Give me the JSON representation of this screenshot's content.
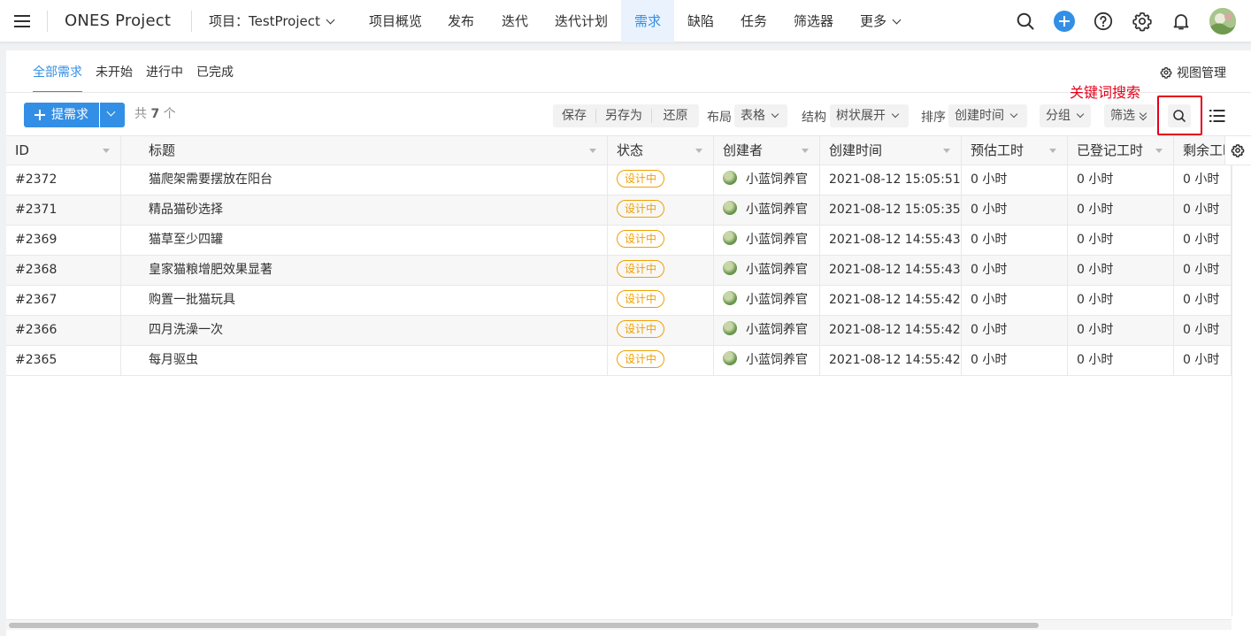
{
  "app": {
    "name": "ONES Project"
  },
  "topnav": {
    "project_label": "项目：TestProject",
    "items": [
      {
        "label": "项目概览"
      },
      {
        "label": "发布"
      },
      {
        "label": "迭代"
      },
      {
        "label": "迭代计划"
      },
      {
        "label": "需求",
        "active": true
      },
      {
        "label": "缺陷"
      },
      {
        "label": "任务"
      },
      {
        "label": "筛选器"
      },
      {
        "label": "更多"
      }
    ],
    "icons": [
      "search-icon",
      "plus-icon",
      "help-icon",
      "gear-icon",
      "bell-icon",
      "avatar"
    ]
  },
  "subtabs": [
    {
      "label": "全部需求",
      "active": true
    },
    {
      "label": "未开始"
    },
    {
      "label": "进行中"
    },
    {
      "label": "已完成"
    }
  ],
  "view_manage": "视图管理",
  "toolbar": {
    "create_label": "提需求",
    "count_prefix": "共",
    "count_value": "7",
    "count_suffix": "个",
    "save": "保存",
    "save_as": "另存为",
    "restore": "还原",
    "layout_label": "布局",
    "layout_value": "表格",
    "structure_label": "结构",
    "structure_value": "树状展开",
    "sort_label": "排序",
    "sort_value": "创建时间",
    "group": "分组",
    "filter": "筛选"
  },
  "annotation": {
    "text": "关键词搜索",
    "color": "#e5001a"
  },
  "table": {
    "columns": [
      "ID",
      "标题",
      "状态",
      "创建者",
      "创建时间",
      "预估工时",
      "已登记工时",
      "剩余工时"
    ],
    "rows": [
      {
        "id": "#2372",
        "title": "猫爬架需要摆放在阳台",
        "status": "设计中",
        "creator": "小蓝饲养官",
        "created": "2021-08-12 15:05:51",
        "estimate": "0 小时",
        "logged": "0 小时",
        "remaining": "0 小时"
      },
      {
        "id": "#2371",
        "title": "精品猫砂选择",
        "status": "设计中",
        "creator": "小蓝饲养官",
        "created": "2021-08-12 15:05:35",
        "estimate": "0 小时",
        "logged": "0 小时",
        "remaining": "0 小时"
      },
      {
        "id": "#2369",
        "title": "猫草至少四罐",
        "status": "设计中",
        "creator": "小蓝饲养官",
        "created": "2021-08-12 14:55:43",
        "estimate": "0 小时",
        "logged": "0 小时",
        "remaining": "0 小时"
      },
      {
        "id": "#2368",
        "title": "皇家猫粮增肥效果显著",
        "status": "设计中",
        "creator": "小蓝饲养官",
        "created": "2021-08-12 14:55:43",
        "estimate": "0 小时",
        "logged": "0 小时",
        "remaining": "0 小时"
      },
      {
        "id": "#2367",
        "title": "购置一批猫玩具",
        "status": "设计中",
        "creator": "小蓝饲养官",
        "created": "2021-08-12 14:55:42",
        "estimate": "0 小时",
        "logged": "0 小时",
        "remaining": "0 小时"
      },
      {
        "id": "#2366",
        "title": "四月洗澡一次",
        "status": "设计中",
        "creator": "小蓝饲养官",
        "created": "2021-08-12 14:55:42",
        "estimate": "0 小时",
        "logged": "0 小时",
        "remaining": "0 小时"
      },
      {
        "id": "#2365",
        "title": "每月驱虫",
        "status": "设计中",
        "creator": "小蓝饲养官",
        "created": "2021-08-12 14:55:42",
        "estimate": "0 小时",
        "logged": "0 小时",
        "remaining": "0 小时"
      }
    ]
  },
  "colors": {
    "accent": "#338fe5",
    "status_design": "#f0a000",
    "annotation": "#e5001a"
  }
}
